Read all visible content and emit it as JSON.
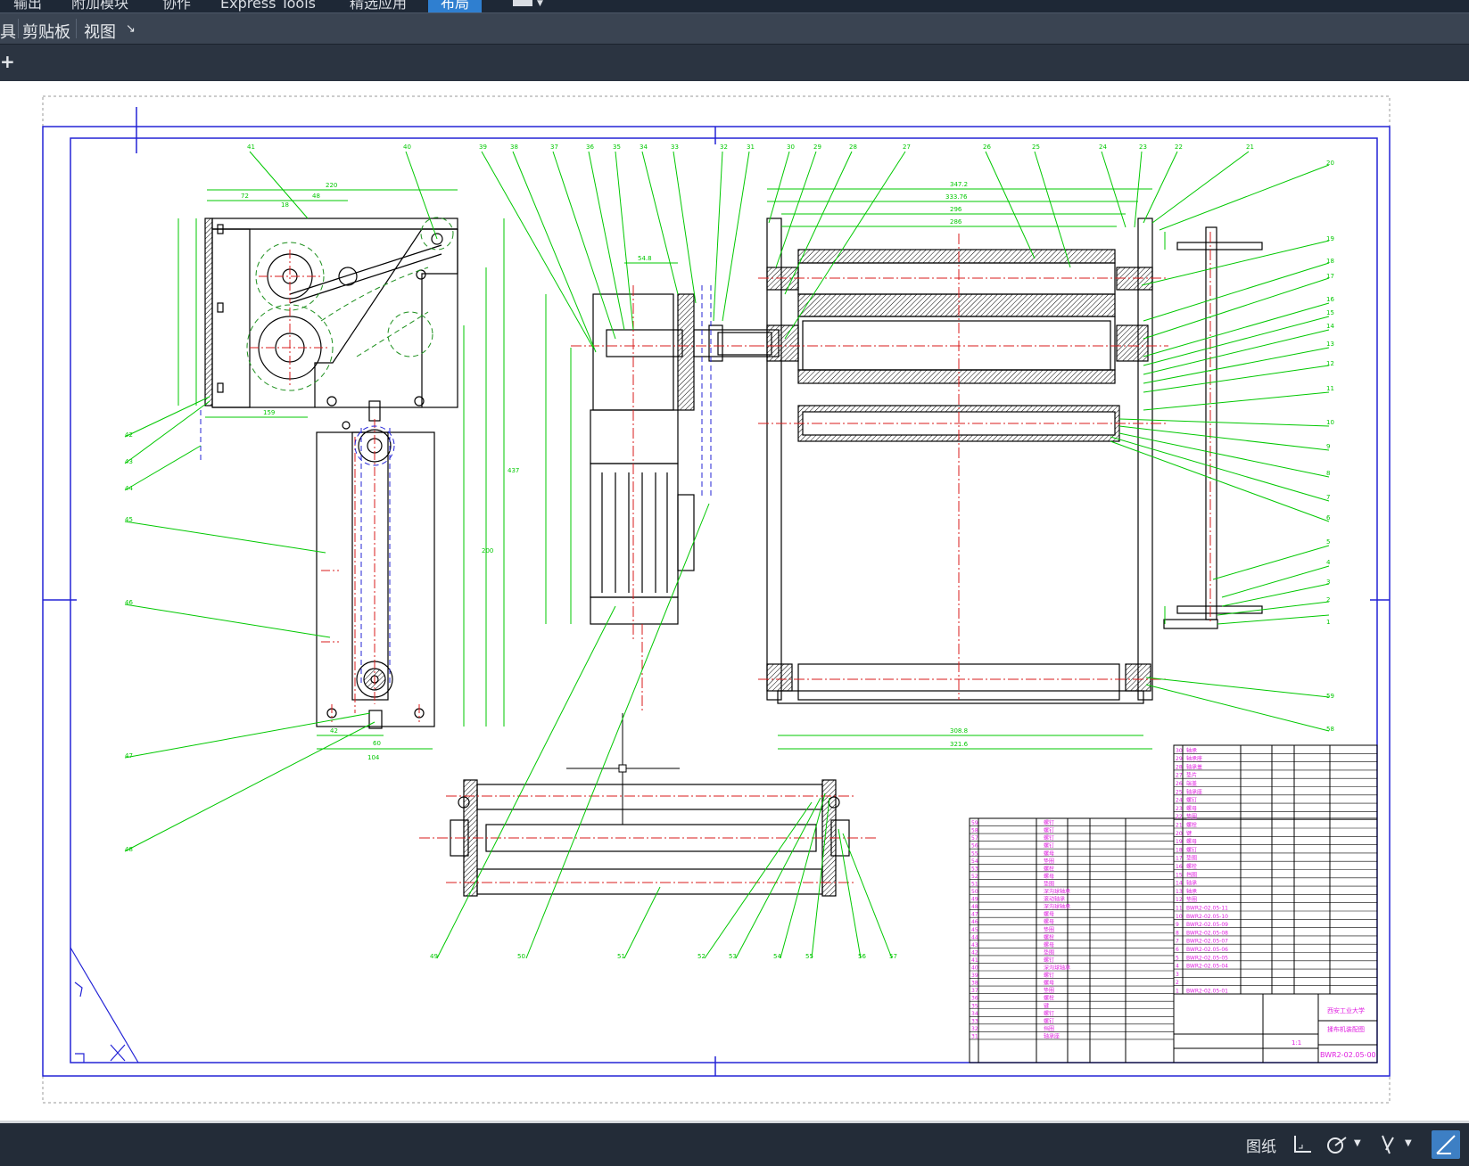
{
  "ribbon": {
    "tabs": [
      {
        "label": "输出"
      },
      {
        "label": "附加模块"
      },
      {
        "label": "协作"
      },
      {
        "label": "Express Tools"
      },
      {
        "label": "精选应用"
      },
      {
        "label": "布局",
        "active": true
      }
    ],
    "panels": {
      "partial_label": "具",
      "clipboard_label": "剪贴板",
      "view_label": "视图",
      "view_expander": "↘"
    }
  },
  "document_bar": {
    "new_tab_label": "+"
  },
  "status_bar": {
    "paper_label": "图纸"
  },
  "drawing": {
    "title_block": {
      "school": "西安工业大学",
      "drawing_name": "揉布机装配图",
      "drawing_number": "BWR2-02.05-00",
      "scale": "1:1"
    },
    "dimensions_text": {
      "d220": "220",
      "d72a": "72",
      "d48": "48",
      "d18": "18",
      "d159": "159",
      "d42": "42",
      "d104": "104",
      "d60": "60",
      "d437": "437",
      "d200": "200",
      "d54": "54.8",
      "d347": "347.2",
      "d333": "333.76",
      "d296": "296",
      "d286": "286",
      "d308": "308.8",
      "d321": "321.6"
    },
    "balloons": [
      "1",
      "2",
      "3",
      "4",
      "5",
      "6",
      "7",
      "8",
      "9",
      "10",
      "11",
      "12",
      "13",
      "14",
      "15",
      "16",
      "17",
      "18",
      "19",
      "20",
      "21",
      "22",
      "23",
      "24",
      "25",
      "26",
      "27",
      "28",
      "29",
      "30",
      "31",
      "32",
      "33",
      "34",
      "35",
      "36",
      "37",
      "38",
      "39",
      "40",
      "41",
      "42",
      "43",
      "44",
      "45",
      "46",
      "47",
      "48",
      "49",
      "50",
      "51",
      "52",
      "53",
      "54",
      "55",
      "56",
      "57",
      "58",
      "59"
    ],
    "parts_left": [
      {
        "no": "59",
        "name": "螺钉"
      },
      {
        "no": "58",
        "name": "螺钉"
      },
      {
        "no": "57",
        "name": "螺钉"
      },
      {
        "no": "56",
        "name": "螺钉"
      },
      {
        "no": "55",
        "name": "螺母"
      },
      {
        "no": "54",
        "name": "垫圈"
      },
      {
        "no": "53",
        "name": "螺栓"
      },
      {
        "no": "52",
        "name": "螺母"
      },
      {
        "no": "51",
        "name": "垫圈"
      },
      {
        "no": "50",
        "name": "深沟球轴承"
      },
      {
        "no": "49",
        "name": "滚动轴承"
      },
      {
        "no": "48",
        "name": "深沟球轴承"
      },
      {
        "no": "47",
        "name": "螺母"
      },
      {
        "no": "46",
        "name": "螺母"
      },
      {
        "no": "45",
        "name": "垫圈"
      },
      {
        "no": "44",
        "name": "螺栓"
      },
      {
        "no": "43",
        "name": "螺母"
      },
      {
        "no": "42",
        "name": "垫圈"
      },
      {
        "no": "41",
        "name": "螺钉"
      },
      {
        "no": "40",
        "name": "深沟球轴承"
      },
      {
        "no": "39",
        "name": "螺钉"
      },
      {
        "no": "38",
        "name": "螺母"
      },
      {
        "no": "37",
        "name": "垫圈"
      },
      {
        "no": "36",
        "name": "螺栓"
      },
      {
        "no": "35",
        "name": "键"
      },
      {
        "no": "34",
        "name": "螺钉"
      },
      {
        "no": "33",
        "name": "螺钉"
      },
      {
        "no": "32",
        "name": "挡圈"
      },
      {
        "no": "31",
        "name": "轴承座"
      }
    ],
    "parts_right": [
      {
        "no": "30",
        "name": "轴承"
      },
      {
        "no": "29",
        "name": "轴承座"
      },
      {
        "no": "28",
        "name": "轴承盖"
      },
      {
        "no": "27",
        "name": "垫片"
      },
      {
        "no": "26",
        "name": "端盖"
      },
      {
        "no": "25",
        "name": "轴承座"
      },
      {
        "no": "24",
        "name": "螺钉"
      },
      {
        "no": "23",
        "name": "螺母"
      },
      {
        "no": "22",
        "name": "垫圈"
      },
      {
        "no": "21",
        "name": "螺栓"
      },
      {
        "no": "20",
        "name": "键"
      },
      {
        "no": "19",
        "name": "螺母"
      },
      {
        "no": "18",
        "name": "螺钉"
      },
      {
        "no": "17",
        "name": "垫圈"
      },
      {
        "no": "16",
        "name": "螺栓"
      },
      {
        "no": "15",
        "name": "挡圈"
      },
      {
        "no": "14",
        "name": "轴承"
      },
      {
        "no": "13",
        "name": "轴承"
      },
      {
        "no": "12",
        "name": "垫圈"
      },
      {
        "no": "11",
        "name": "BWR2-02.05-11"
      },
      {
        "no": "10",
        "name": "BWR2-02.05-10"
      },
      {
        "no": "9",
        "name": "BWR2-02.05-09"
      },
      {
        "no": "8",
        "name": "BWR2-02.05-08"
      },
      {
        "no": "7",
        "name": "BWR2-02.05-07"
      },
      {
        "no": "6",
        "name": "BWR2-02.05-06"
      },
      {
        "no": "5",
        "name": "BWR2-02.05-05"
      },
      {
        "no": "4",
        "name": "BWR2-02.05-04"
      },
      {
        "no": "3",
        "name": ""
      },
      {
        "no": "2",
        "name": ""
      },
      {
        "no": "1",
        "name": "BWR2-02.05-01"
      }
    ]
  }
}
